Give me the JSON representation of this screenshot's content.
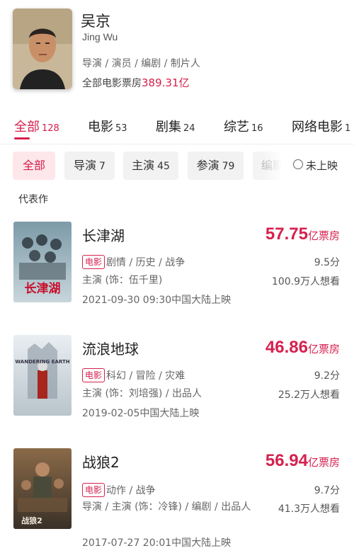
{
  "person": {
    "name_cn": "吴京",
    "name_en": "Jing Wu",
    "roles": "导演 / 演员 / 编剧 / 制片人",
    "box_office_label": "全部电影票房",
    "box_office_value": "389.31亿"
  },
  "category_tabs": [
    {
      "label": "全部",
      "count": "128",
      "active": true
    },
    {
      "label": "电影",
      "count": "53"
    },
    {
      "label": "剧集",
      "count": "24"
    },
    {
      "label": "综艺",
      "count": "16"
    },
    {
      "label": "网络电影",
      "count": "1"
    }
  ],
  "filters": [
    {
      "label": "全部",
      "count": "",
      "active": true
    },
    {
      "label": "导演",
      "count": "7"
    },
    {
      "label": "主演",
      "count": "45"
    },
    {
      "label": "参演",
      "count": "79"
    },
    {
      "label": "编剧",
      "count": ""
    }
  ],
  "unreleased_label": "未上映",
  "section_title": "代表作",
  "movies": [
    {
      "title": "长津湖",
      "box_value": "57.75",
      "box_unit": "亿票房",
      "tag": "电影",
      "genres": "剧情 / 历史 / 战争",
      "score": "9.5分",
      "credit": "主演 (饰：伍千里)",
      "want": "100.9万人想看",
      "release": "2021-09-30 09:30中国大陆上映",
      "poster_text": "长津湖"
    },
    {
      "title": "流浪地球",
      "box_value": "46.86",
      "box_unit": "亿票房",
      "tag": "电影",
      "genres": "科幻 / 冒险 / 灾难",
      "score": "9.2分",
      "credit": "主演 (饰：刘培强) / 出品人",
      "want": "25.2万人想看",
      "release": "2019-02-05中国大陆上映",
      "poster_text": "WANDERING EARTH"
    },
    {
      "title": "战狼2",
      "box_value": "56.94",
      "box_unit": "亿票房",
      "tag": "电影",
      "genres": "动作 / 战争",
      "score": "9.7分",
      "credit": "导演 / 主演 (饰：冷锋) / 编剧 / 出品人",
      "want": "41.3万人想看",
      "release": "2017-07-27 20:01中国大陆上映",
      "poster_text": "战狼2"
    }
  ],
  "colors": {
    "accent": "#d6204e",
    "chip_bg": "#f2f2f2",
    "chip_active_bg": "#fde7ea"
  }
}
